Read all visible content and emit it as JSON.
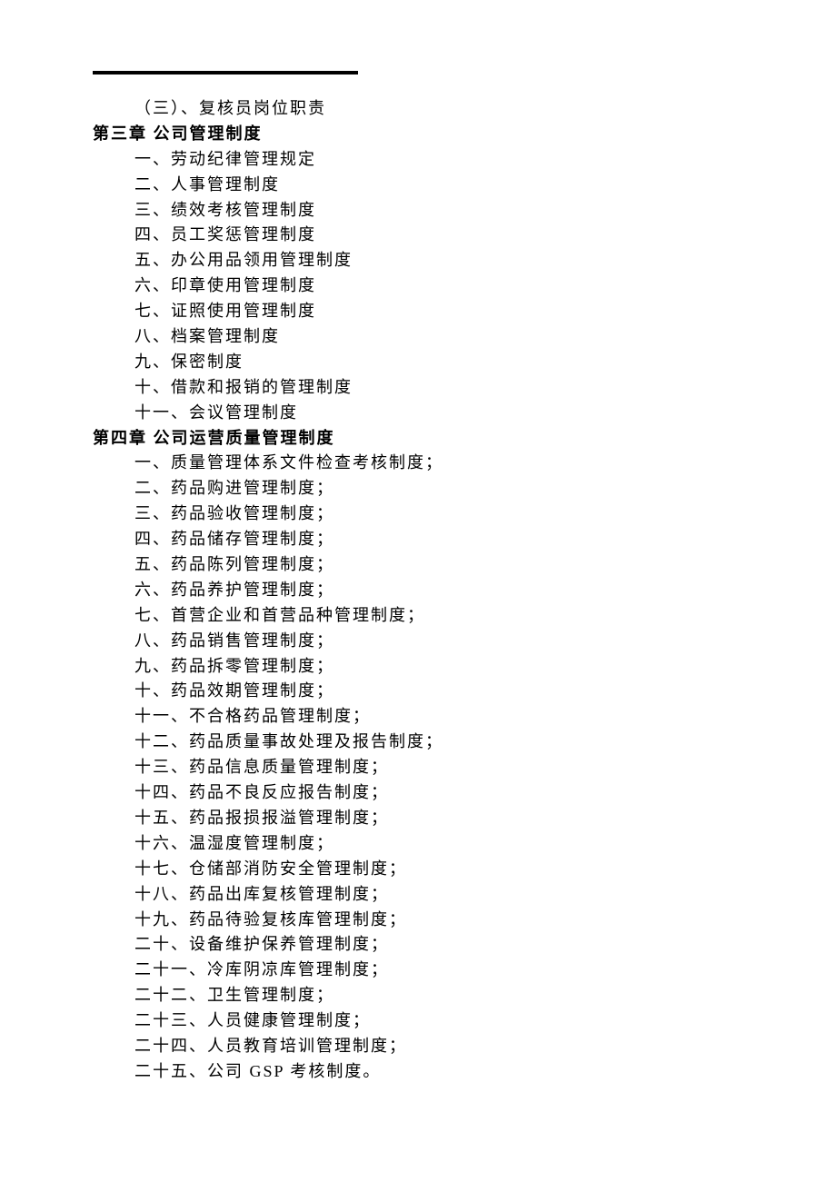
{
  "lines": [
    {
      "text": "（三）、复核员岗位职责",
      "class": "item-indent-1"
    },
    {
      "text": "第三章   公司管理制度",
      "class": "chapter-title"
    },
    {
      "text": "一、劳动纪律管理规定",
      "class": "item-indent-2"
    },
    {
      "text": "二、人事管理制度",
      "class": "item-indent-2"
    },
    {
      "text": "三、绩效考核管理制度",
      "class": "item-indent-2"
    },
    {
      "text": "四、员工奖惩管理制度",
      "class": "item-indent-2"
    },
    {
      "text": "五、办公用品领用管理制度",
      "class": "item-indent-2"
    },
    {
      "text": "六、印章使用管理制度",
      "class": "item-indent-2"
    },
    {
      "text": "七、证照使用管理制度",
      "class": "item-indent-2"
    },
    {
      "text": "八、档案管理制度",
      "class": "item-indent-2"
    },
    {
      "text": "九、保密制度",
      "class": "item-indent-2"
    },
    {
      "text": "十、借款和报销的管理制度",
      "class": "item-indent-2"
    },
    {
      "text": "十一、会议管理制度",
      "class": "item-indent-2"
    },
    {
      "text": "第四章   公司运营质量管理制度",
      "class": "chapter-title"
    },
    {
      "text": "一、质量管理体系文件检查考核制度；",
      "class": "item-indent-2"
    },
    {
      "text": "二、药品购进管理制度；",
      "class": "item-indent-2"
    },
    {
      "text": "三、药品验收管理制度；",
      "class": "item-indent-2"
    },
    {
      "text": "四、药品储存管理制度；",
      "class": "item-indent-2"
    },
    {
      "text": "五、药品陈列管理制度；",
      "class": "item-indent-2"
    },
    {
      "text": "六、药品养护管理制度；",
      "class": "item-indent-2"
    },
    {
      "text": "七、首营企业和首营品种管理制度；",
      "class": "item-indent-2"
    },
    {
      "text": "八、药品销售管理制度；",
      "class": "item-indent-2"
    },
    {
      "text": "九、药品拆零管理制度；",
      "class": "item-indent-2"
    },
    {
      "text": "十、药品效期管理制度；",
      "class": "item-indent-2"
    },
    {
      "text": "十一、不合格药品管理制度；",
      "class": "item-indent-2"
    },
    {
      "text": "十二、药品质量事故处理及报告制度；",
      "class": "item-indent-2"
    },
    {
      "text": "十三、药品信息质量管理制度；",
      "class": "item-indent-2"
    },
    {
      "text": "十四、药品不良反应报告制度；",
      "class": "item-indent-2"
    },
    {
      "text": "十五、药品报损报溢管理制度；",
      "class": "item-indent-2"
    },
    {
      "text": "十六、温湿度管理制度；",
      "class": "item-indent-2"
    },
    {
      "text": "十七、仓储部消防安全管理制度；",
      "class": "item-indent-2"
    },
    {
      "text": "十八、药品出库复核管理制度；",
      "class": "item-indent-2"
    },
    {
      "text": "十九、药品待验复核库管理制度；",
      "class": "item-indent-2"
    },
    {
      "text": "二十、设备维护保养管理制度；",
      "class": "item-indent-2"
    },
    {
      "text": "二十一、冷库阴凉库管理制度；",
      "class": "item-indent-2"
    },
    {
      "text": "二十二、卫生管理制度；",
      "class": "item-indent-2"
    },
    {
      "text": "二十三、人员健康管理制度；",
      "class": "item-indent-2"
    },
    {
      "text": "二十四、人员教育培训管理制度；",
      "class": "item-indent-2"
    },
    {
      "text": "二十五、公司 GSP 考核制度。",
      "class": "item-indent-2"
    }
  ]
}
